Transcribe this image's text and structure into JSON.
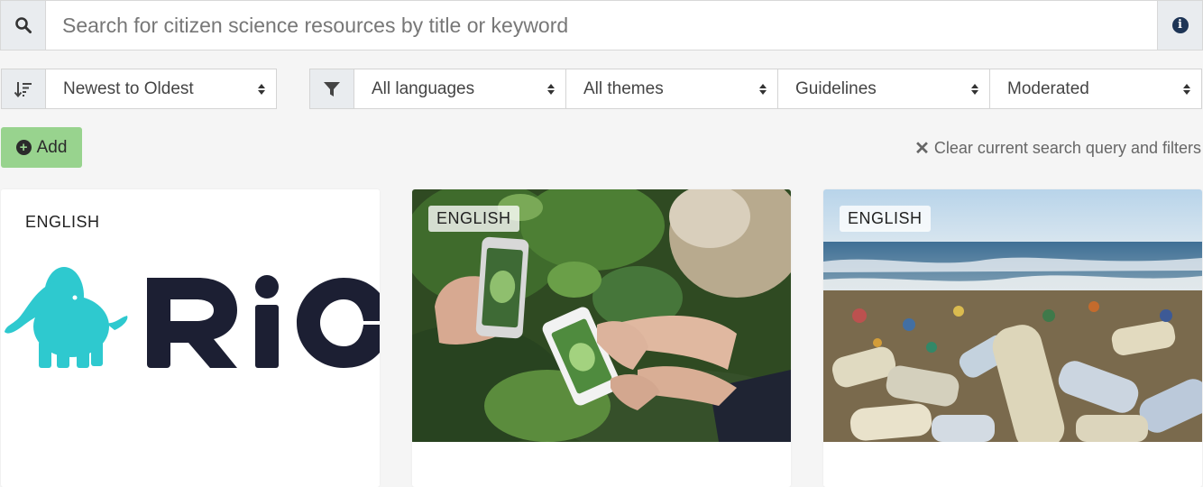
{
  "search": {
    "placeholder": "Search for citizen science resources by title or keyword",
    "value": ""
  },
  "sort": {
    "selected": "Newest to Oldest"
  },
  "filters": [
    {
      "name": "language",
      "selected": "All languages"
    },
    {
      "name": "theme",
      "selected": "All themes"
    },
    {
      "name": "category",
      "selected": "Guidelines"
    },
    {
      "name": "moderation",
      "selected": "Moderated"
    }
  ],
  "actions": {
    "add_label": "Add",
    "clear_label": "Clear current search query and filters"
  },
  "cards": [
    {
      "language": "ENGLISH",
      "image": "rio-logo"
    },
    {
      "language": "ENGLISH",
      "image": "phones-photographing-plants"
    },
    {
      "language": "ENGLISH",
      "image": "plastic-bottles-on-beach"
    }
  ],
  "colors": {
    "add_button": "#98d38e",
    "rio_elephant": "#2ec9cf",
    "rio_text": "#1c1f33",
    "addon_bg": "#e9ecef"
  }
}
